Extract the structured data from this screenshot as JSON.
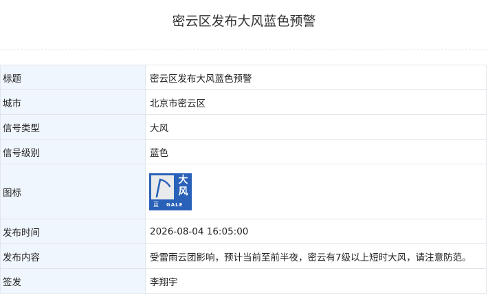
{
  "page": {
    "title": "密云区发布大风蓝色预警"
  },
  "rows": [
    {
      "label": "标题",
      "value": "密云区发布大风蓝色预警"
    },
    {
      "label": "城市",
      "value": "北京市密云区"
    },
    {
      "label": "信号类型",
      "value": "大风"
    },
    {
      "label": "信号级别",
      "value": "蓝色"
    },
    {
      "label": "图标"
    },
    {
      "label": "发布时间",
      "value": "2026-08-04 16:05:00"
    },
    {
      "label": "发布内容",
      "value": "受雷雨云团影响，预计当前至前半夜，密云有7级以上短时大风，请注意防范。"
    },
    {
      "label": "签发",
      "value": "李翔宇"
    }
  ],
  "badge": {
    "icon": "gale-flag-icon",
    "type_char_1": "大",
    "type_char_2": "风",
    "level_char": "蓝",
    "english": "GALE",
    "color": "#2a61b8"
  }
}
